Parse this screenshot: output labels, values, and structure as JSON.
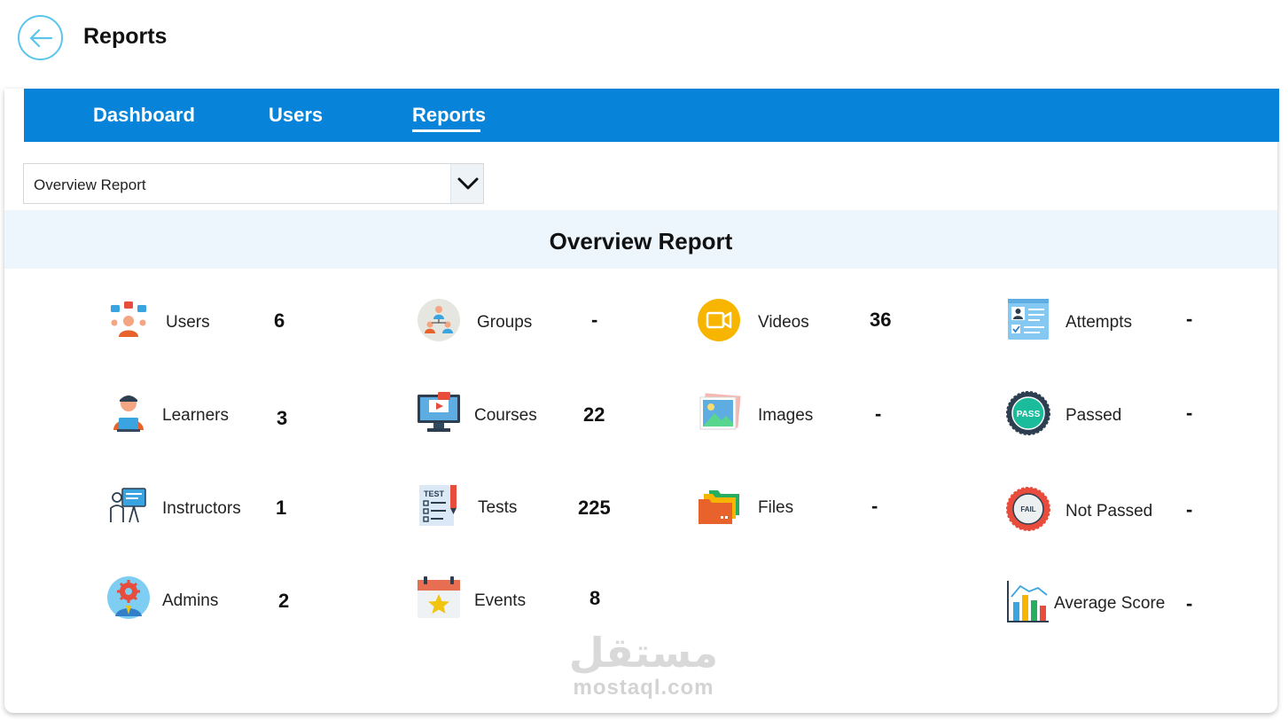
{
  "header": {
    "title": "Reports",
    "back_icon": "arrow-left-icon"
  },
  "nav": {
    "tabs": [
      {
        "label": "Dashboard",
        "active": false
      },
      {
        "label": "Users",
        "active": false
      },
      {
        "label": "Reports",
        "active": true
      }
    ]
  },
  "report_select": {
    "value": "Overview Report",
    "icon": "chevron-down-icon"
  },
  "overview": {
    "title": "Overview Report",
    "stats": [
      {
        "label": "Users",
        "value": "6",
        "icon": "users-network-icon"
      },
      {
        "label": "Learners",
        "value": "3",
        "icon": "learner-icon"
      },
      {
        "label": "Instructors",
        "value": "1",
        "icon": "instructor-icon"
      },
      {
        "label": "Admins",
        "value": "2",
        "icon": "admin-gear-icon"
      },
      {
        "label": "Groups",
        "value": "-",
        "icon": "groups-icon"
      },
      {
        "label": "Courses",
        "value": "22",
        "icon": "video-course-monitor-icon"
      },
      {
        "label": "Tests",
        "value": "225",
        "icon": "test-checklist-icon"
      },
      {
        "label": "Events",
        "value": "8",
        "icon": "calendar-star-icon"
      },
      {
        "label": "Videos",
        "value": "36",
        "icon": "video-camera-icon"
      },
      {
        "label": "Images",
        "value": "-",
        "icon": "image-gallery-icon"
      },
      {
        "label": "Files",
        "value": "-",
        "icon": "folder-icon"
      },
      {
        "label": "Attempts",
        "value": "-",
        "icon": "attempt-card-icon"
      },
      {
        "label": "Passed",
        "value": "-",
        "icon": "pass-badge-icon"
      },
      {
        "label": "Not Passed",
        "value": "-",
        "icon": "fail-badge-icon"
      },
      {
        "label": "Average Score",
        "value": "-",
        "icon": "bar-chart-icon"
      }
    ]
  },
  "watermark": {
    "arabic": "مستقل",
    "latin": "mostaql.com"
  },
  "colors": {
    "nav_bg": "#0784da",
    "band_bg": "#eef6fd",
    "back_ring": "#5bc6ec"
  }
}
